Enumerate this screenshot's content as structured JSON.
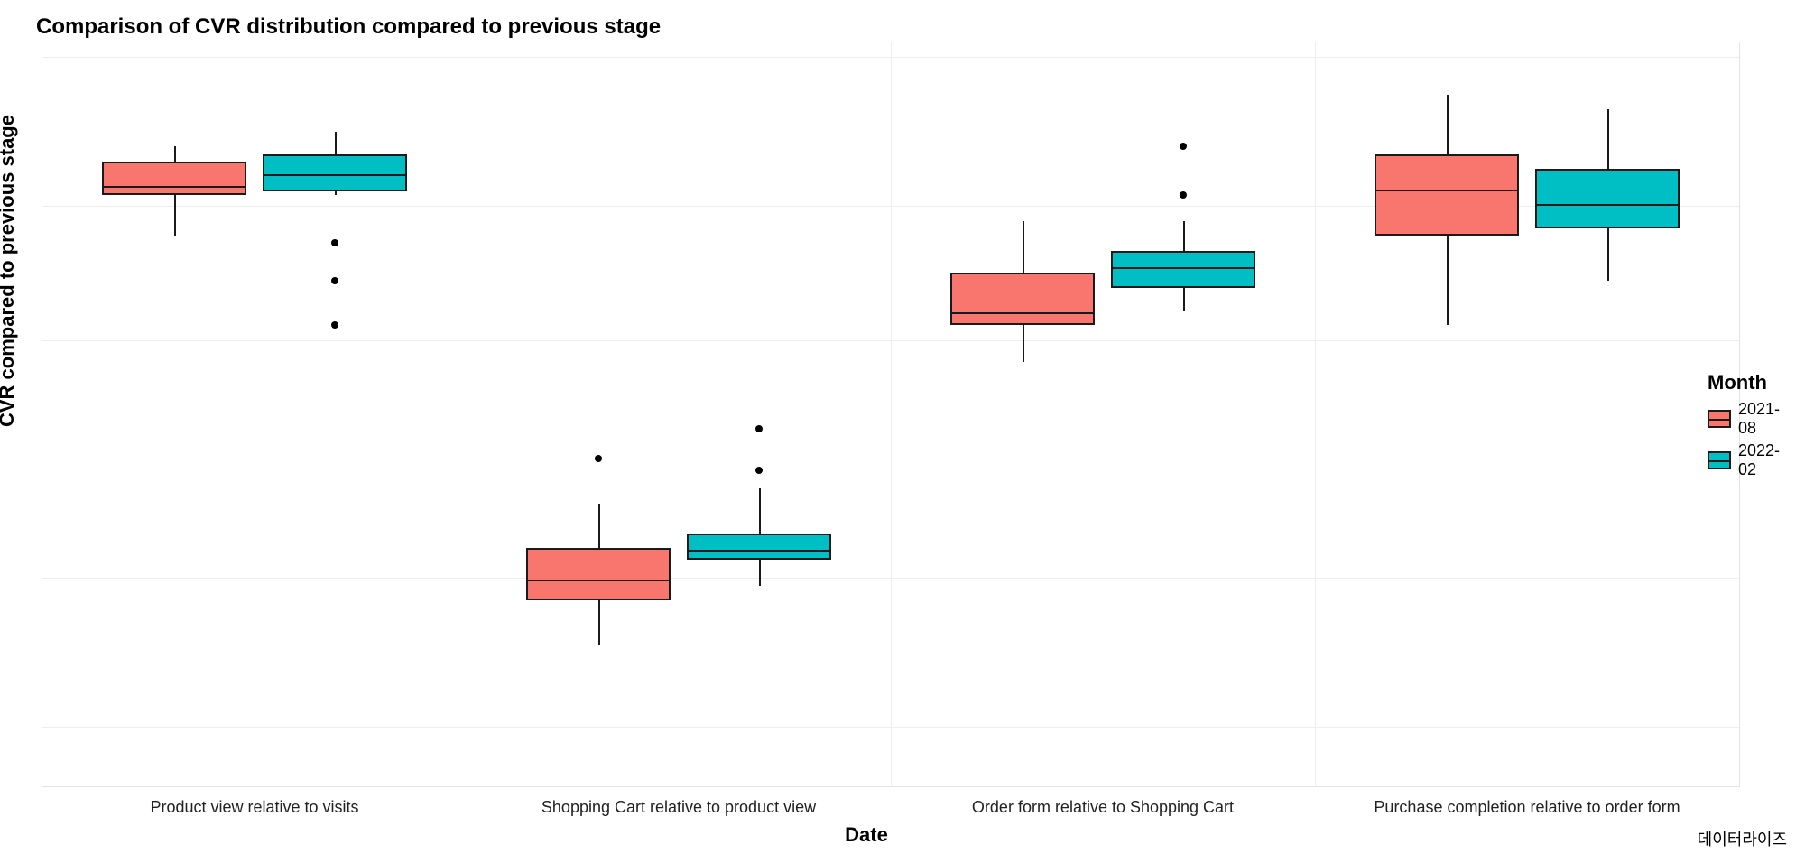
{
  "title": "Comparison of CVR distribution compared to previous stage",
  "ylabel": "CVR compared to previous stage",
  "xlabel": "Date",
  "caption": "데이터라이즈",
  "legend": {
    "title": "Month",
    "items": [
      "2021-08",
      "2022-02"
    ]
  },
  "colors": {
    "2021-08": "#f8766d",
    "2022-02": "#00bfc4"
  },
  "categories": [
    "Product view relative to visits",
    "Shopping Cart relative to product view",
    "Order form relative to Shopping Cart",
    "Purchase completion relative to order form"
  ],
  "chart_data": {
    "type": "boxplot",
    "ylim": [
      0,
      100
    ],
    "gridlines_y": [
      8,
      28,
      60,
      78,
      98
    ],
    "categories": [
      "Product view relative to visits",
      "Shopping Cart relative to product view",
      "Order form relative to Shopping Cart",
      "Purchase completion relative to order form"
    ],
    "series": [
      {
        "name": "2021-08",
        "boxes": [
          {
            "min": 74,
            "q1": 79.5,
            "median": 81,
            "q3": 84,
            "max": 86,
            "outliers": []
          },
          {
            "min": 19,
            "q1": 25,
            "median": 28,
            "q3": 32,
            "max": 38,
            "outliers": [
              44
            ]
          },
          {
            "min": 57,
            "q1": 62,
            "median": 64,
            "q3": 69,
            "max": 76,
            "outliers": []
          },
          {
            "min": 62,
            "q1": 74,
            "median": 80.5,
            "q3": 85,
            "max": 93,
            "outliers": []
          }
        ]
      },
      {
        "name": "2022-02",
        "boxes": [
          {
            "min": 79.5,
            "q1": 80,
            "median": 82.5,
            "q3": 85,
            "max": 88,
            "outliers": [
              73,
              68,
              62
            ]
          },
          {
            "min": 27,
            "q1": 30.5,
            "median": 32,
            "q3": 34,
            "max": 40,
            "outliers": [
              42.5,
              48
            ]
          },
          {
            "min": 64,
            "q1": 67,
            "median": 70,
            "q3": 72,
            "max": 76,
            "outliers": [
              79.5,
              86
            ]
          },
          {
            "min": 68,
            "q1": 75,
            "median": 78.5,
            "q3": 83,
            "max": 91,
            "outliers": []
          }
        ]
      }
    ]
  }
}
